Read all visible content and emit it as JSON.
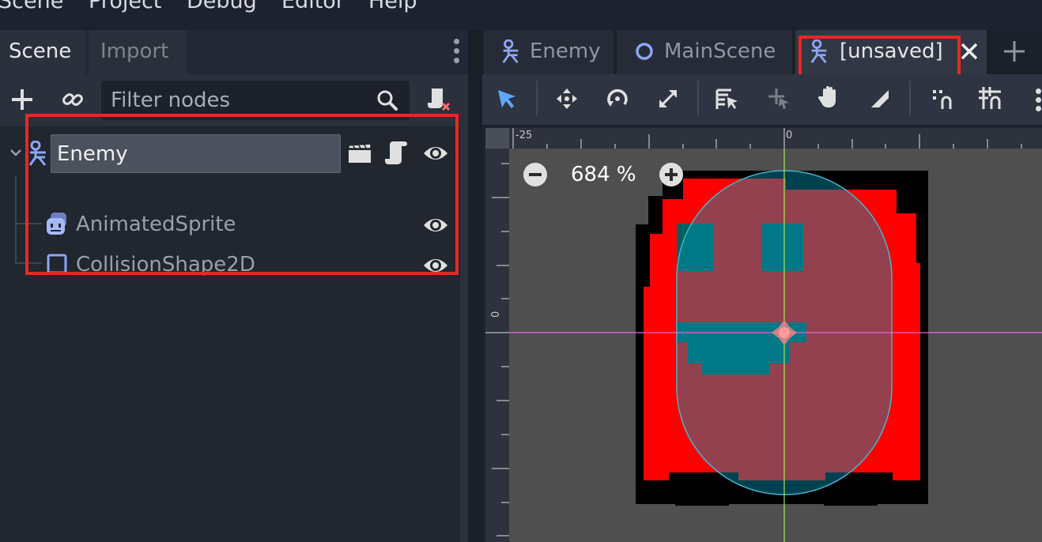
{
  "menu": [
    "Scene",
    "Project",
    "Debug",
    "Editor",
    "Help"
  ],
  "dock": {
    "tabs": [
      "Scene",
      "Import"
    ],
    "filter_placeholder": "Filter nodes"
  },
  "tree": {
    "root": "Enemy",
    "children": [
      "AnimatedSprite",
      "CollisionShape2D"
    ]
  },
  "scene_tabs": [
    "Enemy",
    "MainScene",
    "[unsaved]"
  ],
  "viewport": {
    "zoom": "684 %",
    "ruler_top": [
      "-25",
      "0"
    ],
    "ruler_left": [
      "0"
    ]
  },
  "colors": {
    "accent_icon": "#8da5f3",
    "highlight": "#e32a23",
    "ghost_body": "#ff0000",
    "ghost_face": "#006060",
    "collision_overlay": "#009bbd"
  }
}
